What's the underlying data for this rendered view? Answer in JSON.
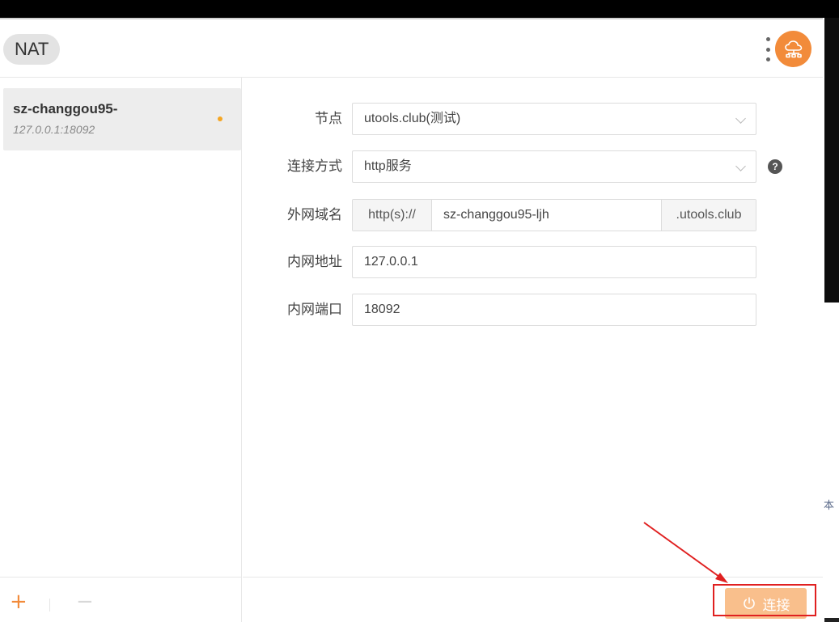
{
  "app": {
    "title": "NAT"
  },
  "header": {
    "more_icon": "more-vertical-icon",
    "avatar_icon": "cloud-network-icon",
    "accent_color": "#f28b3a"
  },
  "sidebar": {
    "items": [
      {
        "name": "sz-changgou95-",
        "address": "127.0.0.1:18092",
        "status_color": "#f5a623"
      }
    ],
    "add_label": "+",
    "remove_label": "−"
  },
  "form": {
    "node": {
      "label": "节点",
      "value": "utools.club(测试)"
    },
    "mode": {
      "label": "连接方式",
      "value": "http服务",
      "help": "?"
    },
    "domain": {
      "label": "外网域名",
      "prefix": "http(s)://",
      "value": "sz-changgou95-ljh",
      "suffix": ".utools.club"
    },
    "host": {
      "label": "内网地址",
      "value": "127.0.0.1"
    },
    "port": {
      "label": "内网端口",
      "value": "18092"
    }
  },
  "footer": {
    "connect_label": "连接",
    "connect_icon": "power-icon",
    "button_color": "#f9bf8c"
  },
  "background": {
    "stub_text": "本"
  }
}
